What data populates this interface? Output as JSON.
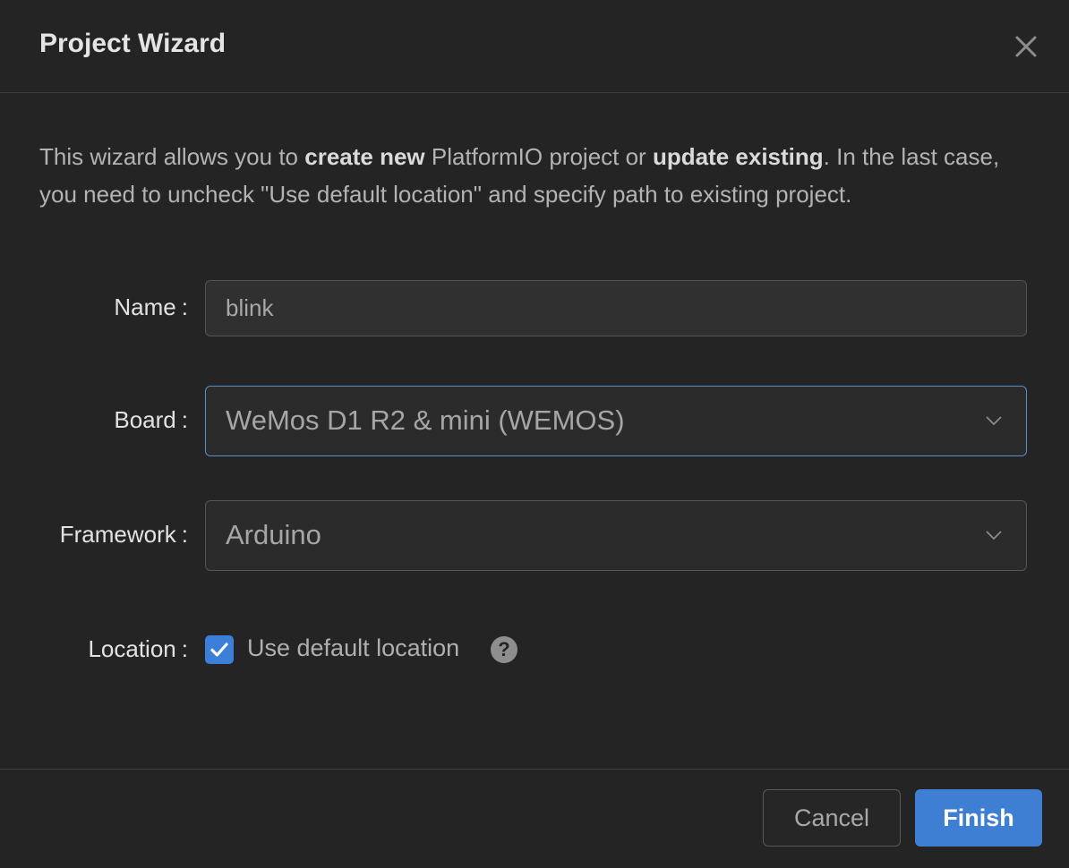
{
  "dialog": {
    "title": "Project Wizard",
    "close_icon": "close-icon"
  },
  "intro": {
    "part1": "This wizard allows you to ",
    "bold1": "create new",
    "part2": " PlatformIO project or ",
    "bold2": "update existing",
    "part3": ". In the last case, you need to uncheck \"Use default location\" and specify path to existing project."
  },
  "form": {
    "name_label": "Name",
    "name_value": "blink",
    "board_label": "Board",
    "board_value": "WeMos D1 R2 & mini (WEMOS)",
    "framework_label": "Framework",
    "framework_value": "Arduino",
    "location_label": "Location",
    "location_checkbox_label": "Use default location",
    "location_checked": true,
    "help_icon": "question-circle-icon",
    "colon": ":"
  },
  "footer": {
    "cancel_label": "Cancel",
    "finish_label": "Finish"
  },
  "colors": {
    "accent": "#3e7fd3",
    "background": "#242424",
    "focus_border": "#5b8dc9"
  }
}
